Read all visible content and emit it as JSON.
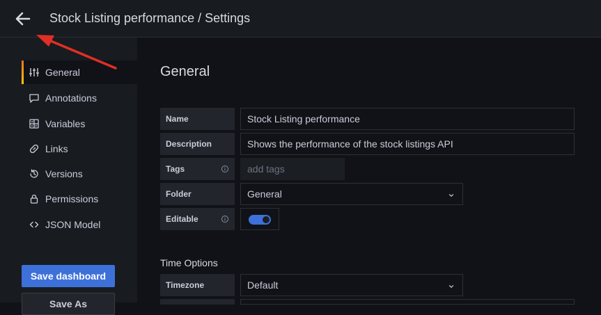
{
  "header": {
    "title": "Stock Listing performance / Settings",
    "back_icon": "arrow-left-icon"
  },
  "sidebar": {
    "items": [
      {
        "label": "General",
        "icon": "sliders-icon",
        "active": true
      },
      {
        "label": "Annotations",
        "icon": "comment-icon",
        "active": false
      },
      {
        "label": "Variables",
        "icon": "calculator-icon",
        "active": false
      },
      {
        "label": "Links",
        "icon": "link-icon",
        "active": false
      },
      {
        "label": "Versions",
        "icon": "history-icon",
        "active": false
      },
      {
        "label": "Permissions",
        "icon": "lock-icon",
        "active": false
      },
      {
        "label": "JSON Model",
        "icon": "code-icon",
        "active": false
      }
    ],
    "save_label": "Save dashboard",
    "save_as_label": "Save As"
  },
  "general": {
    "title": "General",
    "name_label": "Name",
    "name_value": "Stock Listing performance",
    "description_label": "Description",
    "description_value": "Shows the performance of the stock listings API",
    "tags_label": "Tags",
    "tags_placeholder": "add tags",
    "folder_label": "Folder",
    "folder_value": "General",
    "editable_label": "Editable",
    "editable_on": true
  },
  "time_options": {
    "title": "Time Options",
    "timezone_label": "Timezone",
    "timezone_value": "Default"
  },
  "colors": {
    "accent": "#3d71d9",
    "annotation_arrow": "#e02f25",
    "active_indicator": "#f56f21"
  }
}
